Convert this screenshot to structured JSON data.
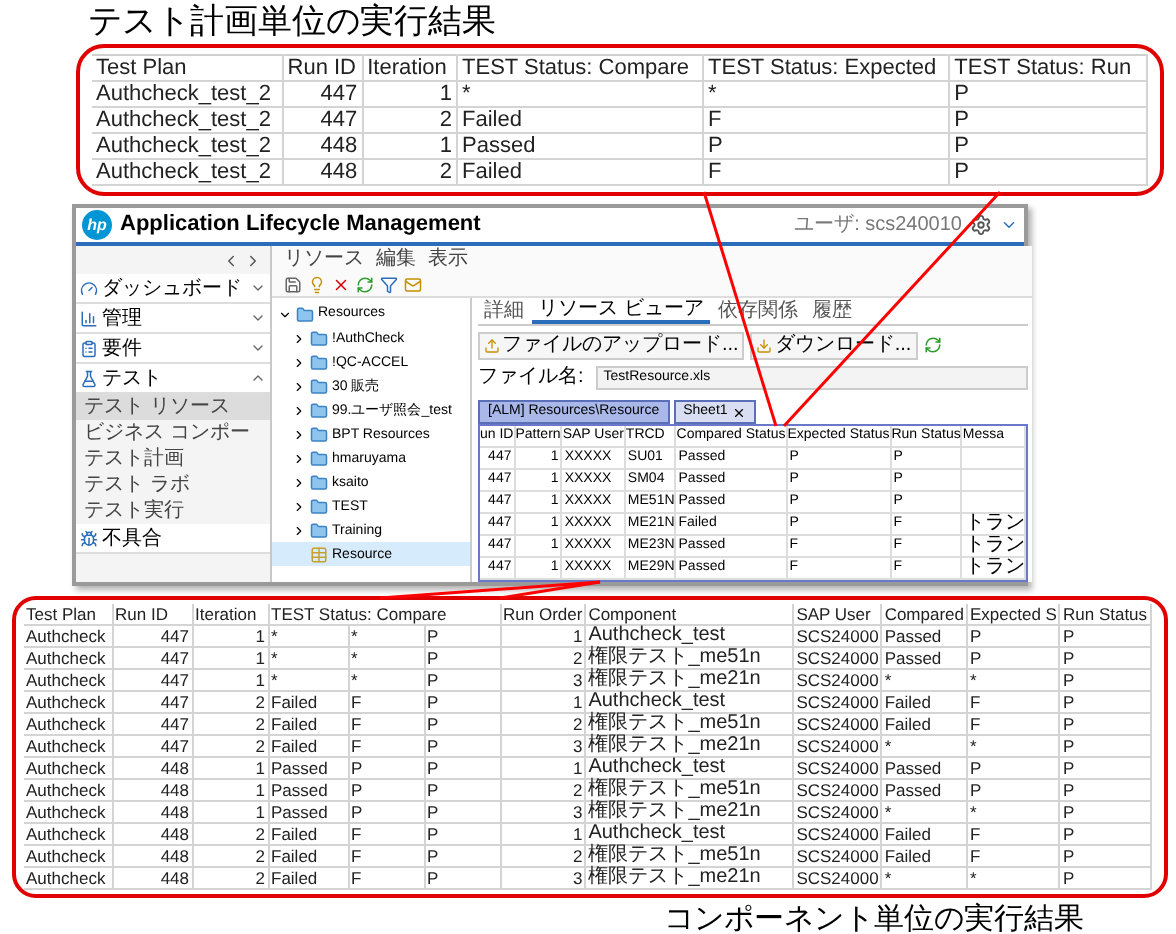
{
  "top_title": "テスト計画単位の実行結果",
  "plan_table": {
    "columns": [
      "Test Plan",
      "Run ID",
      "Iteration",
      "TEST Status: Compare",
      "TEST Status: Expected",
      "TEST Status: Run"
    ],
    "rows": [
      [
        "Authcheck_test_2",
        "447",
        "1",
        "*",
        "*",
        "P"
      ],
      [
        "Authcheck_test_2",
        "447",
        "2",
        "Failed",
        "F",
        "P"
      ],
      [
        "Authcheck_test_2",
        "448",
        "1",
        "Passed",
        "P",
        "P"
      ],
      [
        "Authcheck_test_2",
        "448",
        "2",
        "Failed",
        "F",
        "P"
      ]
    ]
  },
  "app": {
    "logo": "hp",
    "title": "Application Lifecycle Management",
    "user": "ユーザ: scs240010",
    "sidebar": [
      {
        "label": "ダッシュボード",
        "expanded": false
      },
      {
        "label": "管理",
        "expanded": false
      },
      {
        "label": "要件",
        "expanded": false
      },
      {
        "label": "テスト",
        "expanded": true,
        "children": [
          {
            "label": "テスト リソース",
            "selected": true
          },
          {
            "label": "ビジネス コンポー",
            "selected": false
          },
          {
            "label": "テスト計画",
            "selected": false
          },
          {
            "label": "テスト ラボ",
            "selected": false
          },
          {
            "label": "テスト実行",
            "selected": false
          }
        ]
      },
      {
        "label": "不具合"
      }
    ],
    "menu": [
      "リソース",
      "編集",
      "表示"
    ],
    "tree": {
      "label": "Resources",
      "expanded": true,
      "children": [
        {
          "label": "!AuthCheck",
          "kind": "folder",
          "selected": false
        },
        {
          "label": "!QC-ACCEL",
          "kind": "folder",
          "selected": false
        },
        {
          "label": "30 販売",
          "kind": "folder",
          "selected": false
        },
        {
          "label": "99.ユーザ照会_test",
          "kind": "folder",
          "selected": false
        },
        {
          "label": "BPT Resources",
          "kind": "folder",
          "selected": false
        },
        {
          "label": "hmaruyama",
          "kind": "folder",
          "selected": false
        },
        {
          "label": "ksaito",
          "kind": "folder",
          "selected": false
        },
        {
          "label": "TEST",
          "kind": "folder",
          "selected": false
        },
        {
          "label": "Training",
          "kind": "folder",
          "selected": false
        },
        {
          "label": "Resource",
          "kind": "resource",
          "selected": true
        }
      ]
    },
    "tabs": [
      {
        "label": "詳細",
        "selected": false
      },
      {
        "label": "リソース ビューア",
        "selected": true
      },
      {
        "label": "依存関係",
        "selected": false
      },
      {
        "label": "履歴",
        "selected": false
      }
    ],
    "upload_button": "ファイルのアップロード...",
    "download_button": "ダウンロード...",
    "file_field": {
      "label": "ファイル名:",
      "value": "TestResource.xls"
    },
    "sheet_tabs": [
      {
        "label": "[ALM] Resources\\Resource",
        "selected": true
      },
      {
        "label": "Sheet1",
        "selected": false
      }
    ],
    "sheet": {
      "columns": [
        "un ID",
        "Pattern",
        "SAP User",
        "TRCD",
        "Compared Status",
        "Expected Status",
        "Run Status",
        "Messa"
      ],
      "rows": [
        [
          "447",
          "1",
          "XXXXX",
          "SU01",
          "Passed",
          "P",
          "P"
        ],
        [
          "447",
          "1",
          "XXXXX",
          "SM04",
          "Passed",
          "P",
          "P"
        ],
        [
          "447",
          "1",
          "XXXXX",
          "ME51N",
          "Passed",
          "P",
          "P"
        ],
        [
          "447",
          "1",
          "XXXXX",
          "ME21N",
          "Failed",
          "P",
          "F",
          "トラン"
        ],
        [
          "447",
          "1",
          "XXXXX",
          "ME23N",
          "Passed",
          "F",
          "F",
          "トラン"
        ],
        [
          "447",
          "1",
          "XXXXX",
          "ME29N",
          "Passed",
          "F",
          "F",
          "トラン"
        ]
      ]
    }
  },
  "component_table": {
    "columns": [
      {
        "label": "Test Plan"
      },
      {
        "label": "Run ID"
      },
      {
        "label": "Iteration"
      },
      {
        "label": "TEST Status: Compare",
        "colspan": 3
      },
      {
        "label": "Run Order"
      },
      {
        "label": "Component"
      },
      {
        "label": "SAP User"
      },
      {
        "label": "Compared"
      },
      {
        "label": "Expected S"
      },
      {
        "label": "Run Status"
      }
    ],
    "rows": [
      [
        "Authcheck",
        "447",
        "1",
        "*",
        "*",
        "P",
        "1",
        "Authcheck_test",
        "SCS24000",
        "Passed",
        "P",
        "P"
      ],
      [
        "Authcheck",
        "447",
        "1",
        "*",
        "*",
        "P",
        "2",
        "権限テスト_me51n",
        "SCS24000",
        "Passed",
        "P",
        "P"
      ],
      [
        "Authcheck",
        "447",
        "1",
        "*",
        "*",
        "P",
        "3",
        "権限テスト_me21n",
        "SCS24000",
        "*",
        "*",
        "P"
      ],
      [
        "Authcheck",
        "447",
        "2",
        "Failed",
        "F",
        "P",
        "1",
        "Authcheck_test",
        "SCS24000",
        "Failed",
        "F",
        "P"
      ],
      [
        "Authcheck",
        "447",
        "2",
        "Failed",
        "F",
        "P",
        "2",
        "権限テスト_me51n",
        "SCS24000",
        "Failed",
        "F",
        "P"
      ],
      [
        "Authcheck",
        "447",
        "2",
        "Failed",
        "F",
        "P",
        "3",
        "権限テスト_me21n",
        "SCS24000",
        "*",
        "*",
        "P"
      ],
      [
        "Authcheck",
        "448",
        "1",
        "Passed",
        "P",
        "P",
        "1",
        "Authcheck_test",
        "SCS24000",
        "Passed",
        "P",
        "P"
      ],
      [
        "Authcheck",
        "448",
        "1",
        "Passed",
        "P",
        "P",
        "2",
        "権限テスト_me51n",
        "SCS24000",
        "Passed",
        "P",
        "P"
      ],
      [
        "Authcheck",
        "448",
        "1",
        "Passed",
        "P",
        "P",
        "3",
        "権限テスト_me21n",
        "SCS24000",
        "*",
        "*",
        "P"
      ],
      [
        "Authcheck",
        "448",
        "2",
        "Failed",
        "F",
        "P",
        "1",
        "Authcheck_test",
        "SCS24000",
        "Failed",
        "F",
        "P"
      ],
      [
        "Authcheck",
        "448",
        "2",
        "Failed",
        "F",
        "P",
        "2",
        "権限テスト_me51n",
        "SCS24000",
        "Failed",
        "F",
        "P"
      ],
      [
        "Authcheck",
        "448",
        "2",
        "Failed",
        "F",
        "P",
        "3",
        "権限テスト_me21n",
        "SCS24000",
        "*",
        "*",
        "P"
      ]
    ]
  },
  "bottom_title": "コンポーネント単位の実行結果"
}
